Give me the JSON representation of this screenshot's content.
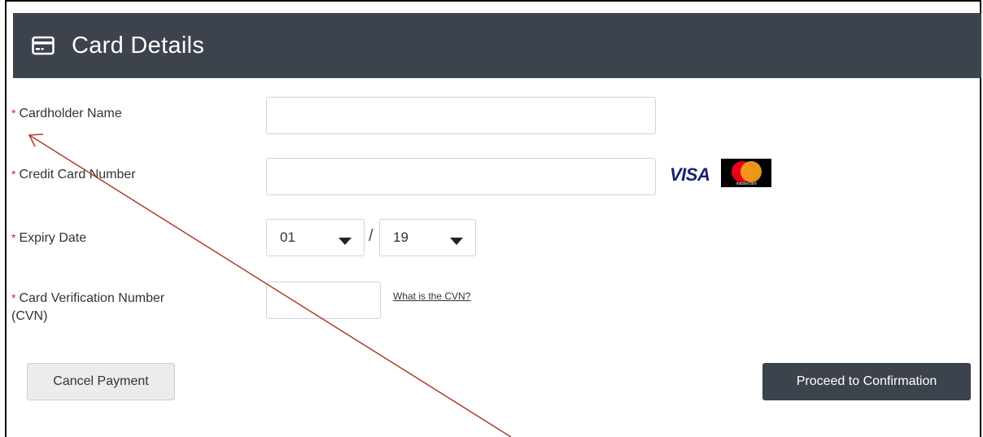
{
  "header": {
    "title": "Card Details",
    "icon": "credit-card-icon"
  },
  "fields": {
    "cardholder_name": {
      "label": "Cardholder Name",
      "required_mark": "*",
      "value": ""
    },
    "card_number": {
      "label": "Credit Card Number",
      "required_mark": "*",
      "value": ""
    },
    "expiry": {
      "label": "Expiry Date",
      "required_mark": "*",
      "month": "01",
      "year": "19",
      "separator": "/"
    },
    "cvn": {
      "label_line1": "Card Verification Number",
      "label_line2": "(CVN)",
      "required_mark": "*",
      "value": "",
      "help_link": "What is the CVN?"
    }
  },
  "card_logos": {
    "visa": "VISA",
    "mastercard": "mastercard"
  },
  "buttons": {
    "cancel": "Cancel Payment",
    "proceed": "Proceed to Confirmation"
  },
  "colors": {
    "header_bg": "#3d434c",
    "required": "#d0202f",
    "annotation_arrow": "#b03a2e"
  }
}
